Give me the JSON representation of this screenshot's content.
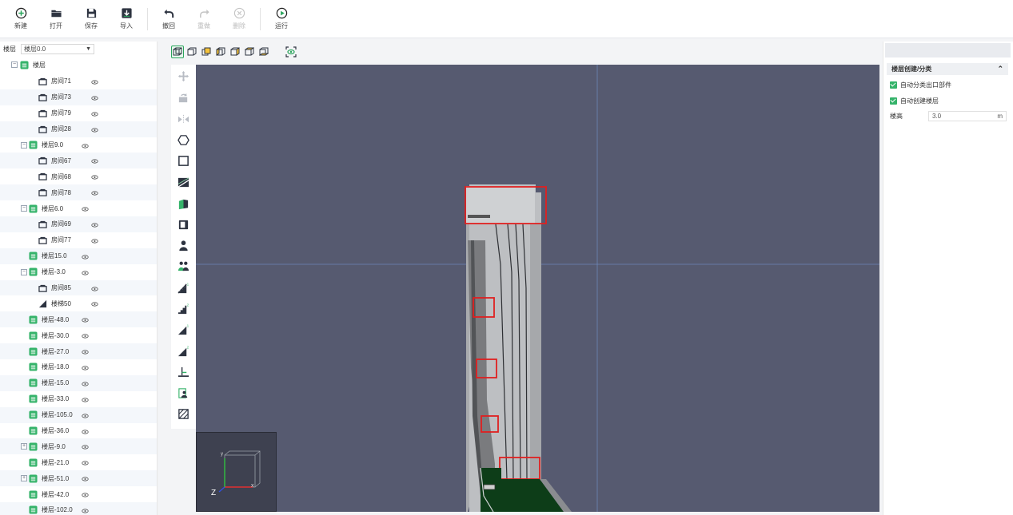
{
  "toolbar": {
    "new_label": "新建",
    "open_label": "打开",
    "save_label": "保存",
    "import_label": "导入",
    "undo_label": "撤回",
    "redo_label": "重做",
    "delete_label": "删除",
    "run_label": "运行"
  },
  "left_panel": {
    "layer_label": "楼层",
    "layer_select_value": "楼层0.0",
    "root_label": "楼层",
    "tree": [
      {
        "label": "房间71",
        "level": 2,
        "kind": "room"
      },
      {
        "label": "房间73",
        "level": 2,
        "kind": "room"
      },
      {
        "label": "房间79",
        "level": 2,
        "kind": "room"
      },
      {
        "label": "房间28",
        "level": 2,
        "kind": "room"
      },
      {
        "label": "楼层9.0",
        "level": 1,
        "kind": "floor",
        "toggle": "−"
      },
      {
        "label": "房间67",
        "level": 2,
        "kind": "room"
      },
      {
        "label": "房间68",
        "level": 2,
        "kind": "room"
      },
      {
        "label": "房间78",
        "level": 2,
        "kind": "room"
      },
      {
        "label": "楼层6.0",
        "level": 1,
        "kind": "floor",
        "toggle": "−"
      },
      {
        "label": "房间69",
        "level": 2,
        "kind": "room"
      },
      {
        "label": "房间77",
        "level": 2,
        "kind": "room"
      },
      {
        "label": "楼层15.0",
        "level": 1,
        "kind": "floor"
      },
      {
        "label": "楼层-3.0",
        "level": 1,
        "kind": "floor",
        "toggle": "−"
      },
      {
        "label": "房间85",
        "level": 2,
        "kind": "room"
      },
      {
        "label": "楼梯50",
        "level": 2,
        "kind": "stair"
      },
      {
        "label": "楼层-48.0",
        "level": 1,
        "kind": "floor"
      },
      {
        "label": "楼层-30.0",
        "level": 1,
        "kind": "floor"
      },
      {
        "label": "楼层-27.0",
        "level": 1,
        "kind": "floor"
      },
      {
        "label": "楼层-18.0",
        "level": 1,
        "kind": "floor"
      },
      {
        "label": "楼层-15.0",
        "level": 1,
        "kind": "floor"
      },
      {
        "label": "楼层-33.0",
        "level": 1,
        "kind": "floor"
      },
      {
        "label": "楼层-105.0",
        "level": 1,
        "kind": "floor"
      },
      {
        "label": "楼层-36.0",
        "level": 1,
        "kind": "floor"
      },
      {
        "label": "楼层-9.0",
        "level": 1,
        "kind": "floor",
        "toggle": "+"
      },
      {
        "label": "楼层-21.0",
        "level": 1,
        "kind": "floor"
      },
      {
        "label": "楼层-51.0",
        "level": 1,
        "kind": "floor",
        "toggle": "+"
      },
      {
        "label": "楼层-42.0",
        "level": 1,
        "kind": "floor"
      },
      {
        "label": "楼层-102.0",
        "level": 1,
        "kind": "floor"
      }
    ]
  },
  "view_tools": [
    "cube-perspective-icon",
    "cube-front-icon",
    "cube-back-icon",
    "cube-left-icon",
    "cube-right-icon",
    "cube-top-icon",
    "cube-bottom-icon"
  ],
  "axis": {
    "y": "y",
    "x": "x",
    "z": "Z"
  },
  "right_panel": {
    "section_title": "楼层创建/分类",
    "collapse_icon": "chevron-up-icon",
    "check1": "自动分类出口部件",
    "check2": "自动创建楼层",
    "height_label": "楼高",
    "height_value": "3.0",
    "height_unit": "m"
  },
  "colors": {
    "accent": "#35b36a",
    "viewport_bg": "#565a70",
    "highlight_red": "#e02020",
    "ground_green": "#0d3d18"
  }
}
